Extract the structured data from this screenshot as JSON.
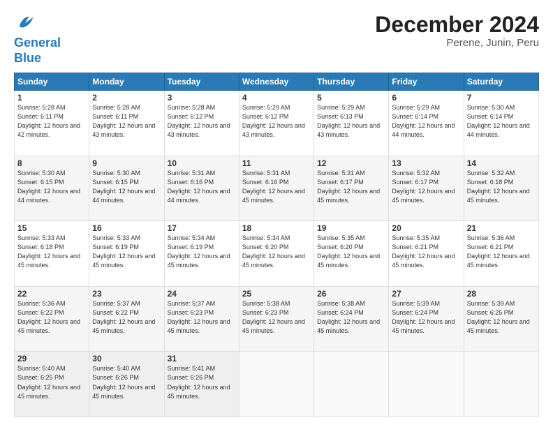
{
  "logo": {
    "line1": "General",
    "line2": "Blue"
  },
  "title": "December 2024",
  "subtitle": "Perene, Junin, Peru",
  "days_of_week": [
    "Sunday",
    "Monday",
    "Tuesday",
    "Wednesday",
    "Thursday",
    "Friday",
    "Saturday"
  ],
  "weeks": [
    [
      {
        "day": "1",
        "rise": "5:28 AM",
        "set": "6:11 PM",
        "hours": "12 hours and 42 minutes."
      },
      {
        "day": "2",
        "rise": "5:28 AM",
        "set": "6:11 PM",
        "hours": "12 hours and 43 minutes."
      },
      {
        "day": "3",
        "rise": "5:28 AM",
        "set": "6:12 PM",
        "hours": "12 hours and 43 minutes."
      },
      {
        "day": "4",
        "rise": "5:29 AM",
        "set": "6:12 PM",
        "hours": "12 hours and 43 minutes."
      },
      {
        "day": "5",
        "rise": "5:29 AM",
        "set": "6:13 PM",
        "hours": "12 hours and 43 minutes."
      },
      {
        "day": "6",
        "rise": "5:29 AM",
        "set": "6:14 PM",
        "hours": "12 hours and 44 minutes."
      },
      {
        "day": "7",
        "rise": "5:30 AM",
        "set": "6:14 PM",
        "hours": "12 hours and 44 minutes."
      }
    ],
    [
      {
        "day": "8",
        "rise": "5:30 AM",
        "set": "6:15 PM",
        "hours": "12 hours and 44 minutes."
      },
      {
        "day": "9",
        "rise": "5:30 AM",
        "set": "6:15 PM",
        "hours": "12 hours and 44 minutes."
      },
      {
        "day": "10",
        "rise": "5:31 AM",
        "set": "6:16 PM",
        "hours": "12 hours and 44 minutes."
      },
      {
        "day": "11",
        "rise": "5:31 AM",
        "set": "6:16 PM",
        "hours": "12 hours and 45 minutes."
      },
      {
        "day": "12",
        "rise": "5:31 AM",
        "set": "6:17 PM",
        "hours": "12 hours and 45 minutes."
      },
      {
        "day": "13",
        "rise": "5:32 AM",
        "set": "6:17 PM",
        "hours": "12 hours and 45 minutes."
      },
      {
        "day": "14",
        "rise": "5:32 AM",
        "set": "6:18 PM",
        "hours": "12 hours and 45 minutes."
      }
    ],
    [
      {
        "day": "15",
        "rise": "5:33 AM",
        "set": "6:18 PM",
        "hours": "12 hours and 45 minutes."
      },
      {
        "day": "16",
        "rise": "5:33 AM",
        "set": "6:19 PM",
        "hours": "12 hours and 45 minutes."
      },
      {
        "day": "17",
        "rise": "5:34 AM",
        "set": "6:19 PM",
        "hours": "12 hours and 45 minutes."
      },
      {
        "day": "18",
        "rise": "5:34 AM",
        "set": "6:20 PM",
        "hours": "12 hours and 45 minutes."
      },
      {
        "day": "19",
        "rise": "5:35 AM",
        "set": "6:20 PM",
        "hours": "12 hours and 45 minutes."
      },
      {
        "day": "20",
        "rise": "5:35 AM",
        "set": "6:21 PM",
        "hours": "12 hours and 45 minutes."
      },
      {
        "day": "21",
        "rise": "5:36 AM",
        "set": "6:21 PM",
        "hours": "12 hours and 45 minutes."
      }
    ],
    [
      {
        "day": "22",
        "rise": "5:36 AM",
        "set": "6:22 PM",
        "hours": "12 hours and 45 minutes."
      },
      {
        "day": "23",
        "rise": "5:37 AM",
        "set": "6:22 PM",
        "hours": "12 hours and 45 minutes."
      },
      {
        "day": "24",
        "rise": "5:37 AM",
        "set": "6:23 PM",
        "hours": "12 hours and 45 minutes."
      },
      {
        "day": "25",
        "rise": "5:38 AM",
        "set": "6:23 PM",
        "hours": "12 hours and 45 minutes."
      },
      {
        "day": "26",
        "rise": "5:38 AM",
        "set": "6:24 PM",
        "hours": "12 hours and 45 minutes."
      },
      {
        "day": "27",
        "rise": "5:39 AM",
        "set": "6:24 PM",
        "hours": "12 hours and 45 minutes."
      },
      {
        "day": "28",
        "rise": "5:39 AM",
        "set": "6:25 PM",
        "hours": "12 hours and 45 minutes."
      }
    ],
    [
      {
        "day": "29",
        "rise": "5:40 AM",
        "set": "6:25 PM",
        "hours": "12 hours and 45 minutes."
      },
      {
        "day": "30",
        "rise": "5:40 AM",
        "set": "6:26 PM",
        "hours": "12 hours and 45 minutes."
      },
      {
        "day": "31",
        "rise": "5:41 AM",
        "set": "6:26 PM",
        "hours": "12 hours and 45 minutes."
      },
      null,
      null,
      null,
      null
    ]
  ]
}
